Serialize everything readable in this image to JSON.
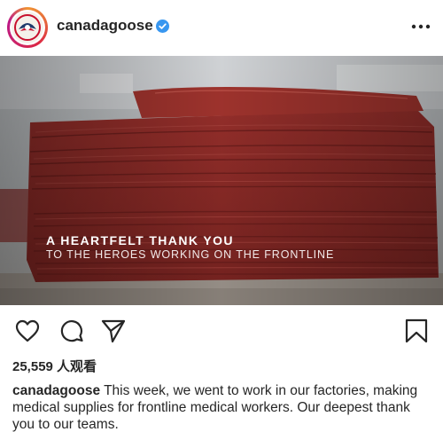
{
  "post": {
    "username": "canadagoose",
    "verified": true,
    "overlay_title": "A HEARTFELT THANK YOU",
    "overlay_subtitle": "TO THE HEROES WORKING ON THE FRONTLINE",
    "views": "25,559 人观看",
    "caption_text": "This week, we went to work in our factories, making medical supplies for frontline medical workers. Our deepest thank you to our teams."
  },
  "icons": {
    "verified": "verified-badge-icon",
    "more": "more-options-icon",
    "like": "heart-icon",
    "comment": "comment-icon",
    "share": "paper-plane-icon",
    "save": "bookmark-icon"
  },
  "colors": {
    "verified_blue": "#3897f0",
    "text": "#262626",
    "fabric_red": "#8a2a27"
  }
}
